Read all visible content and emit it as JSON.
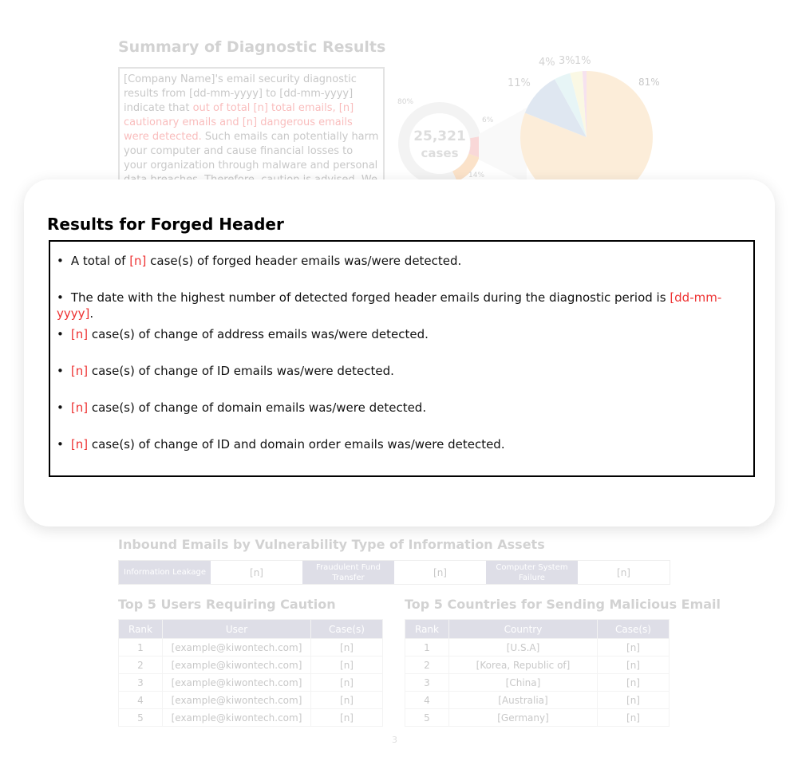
{
  "background": {
    "summary_title": "Summary of Diagnostic Results",
    "summary_text": {
      "a": "[Company Name]'s email security diagnostic results from [dd-mm-yyyy] to [dd-mm-yyyy] indicate that ",
      "b": "out of total [n] total emails, [n] cautionary emails and [n] dangerous emails were detected.",
      "c": " Such emails can potentially harm your computer and cause financial losses to your organization through malware and personal data breaches. Therefore, caution is advised. We recommend updating your current email"
    },
    "donut": {
      "center_value": "25,321",
      "center_unit": "cases",
      "labels": [
        "80%",
        "6%",
        "14%"
      ]
    },
    "pie": {
      "labels": [
        "81%",
        "11%",
        "4%",
        "3%",
        "1%"
      ],
      "values": [
        81,
        11,
        4,
        3,
        1
      ],
      "colors": [
        "#f7c98a",
        "#9fb6d4",
        "#b8e2e6",
        "#f1ebad",
        "#e6a7cf"
      ]
    },
    "vuln_title": "Inbound Emails by Vulnerability Type of Information Assets",
    "vuln": [
      {
        "k": "Information Leakage",
        "v": "[n]"
      },
      {
        "k": "Fraudulent Fund Transfer",
        "v": "[n]"
      },
      {
        "k": "Computer System Failure",
        "v": "[n]"
      }
    ],
    "users_title": "Top 5 Users Requiring Caution",
    "users_headers": [
      "Rank",
      "User",
      "Case(s)"
    ],
    "users": [
      [
        "1",
        "[example@kiwontech.com]",
        "[n]"
      ],
      [
        "2",
        "[example@kiwontech.com]",
        "[n]"
      ],
      [
        "3",
        "[example@kiwontech.com]",
        "[n]"
      ],
      [
        "4",
        "[example@kiwontech.com]",
        "[n]"
      ],
      [
        "5",
        "[example@kiwontech.com]",
        "[n]"
      ]
    ],
    "countries_title": "Top 5 Countries for Sending Malicious Email",
    "countries_headers": [
      "Rank",
      "Country",
      "Case(s)"
    ],
    "countries": [
      [
        "1",
        "[U.S.A]",
        "[n]"
      ],
      [
        "2",
        "[Korea, Republic of]",
        "[n]"
      ],
      [
        "3",
        "[China]",
        "[n]"
      ],
      [
        "4",
        "[Australia]",
        "[n]"
      ],
      [
        "5",
        "[Germany]",
        "[n]"
      ]
    ],
    "page_number": "3"
  },
  "card": {
    "title": "Results for Forged Header",
    "items": [
      {
        "pre": "A total of ",
        "red": "[n]",
        "post": " case(s) of forged header emails was/were detected."
      },
      {
        "pre": "The date with the highest number of detected forged header emails during the diagnostic period is ",
        "red": "[dd-mm-yyyy]",
        "post": "."
      },
      {
        "pre": "",
        "red": "[n]",
        "post": " case(s) of change of address emails was/were detected."
      },
      {
        "pre": "",
        "red": "[n]",
        "post": " case(s) of change of ID emails was/were detected."
      },
      {
        "pre": "",
        "red": "[n]",
        "post": " case(s) of change of domain emails was/were detected."
      },
      {
        "pre": "",
        "red": "[n]",
        "post": " case(s) of change of ID and domain order emails was/were detected."
      }
    ]
  }
}
